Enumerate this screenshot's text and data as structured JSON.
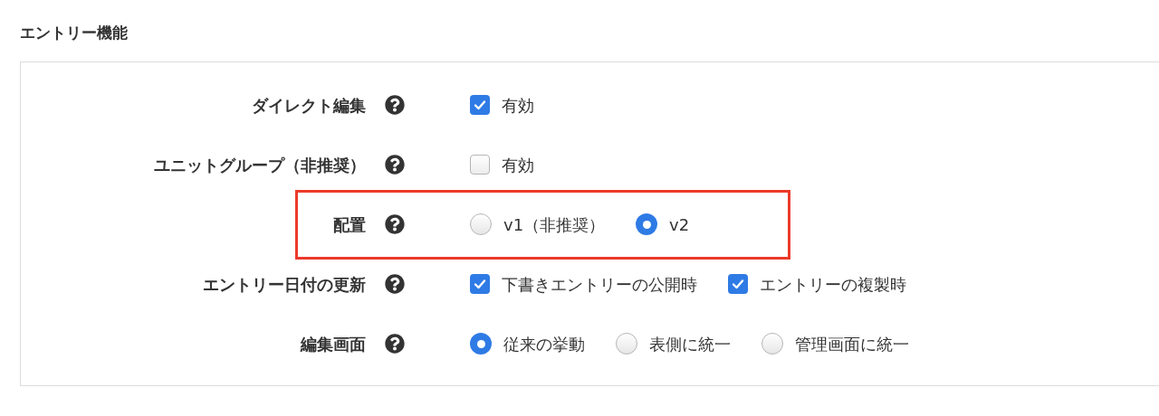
{
  "section_title": "エントリー機能",
  "rows": [
    {
      "label": "ダイレクト編集",
      "kind": "checkbox",
      "highlighted": false,
      "options": [
        {
          "label": "有効",
          "checked": true
        }
      ]
    },
    {
      "label": "ユニットグループ（非推奨）",
      "kind": "checkbox",
      "highlighted": false,
      "options": [
        {
          "label": "有効",
          "checked": false
        }
      ]
    },
    {
      "label": "配置",
      "kind": "radio",
      "highlighted": true,
      "options": [
        {
          "label": "v1（非推奨）",
          "selected": false
        },
        {
          "label": "v2",
          "selected": true
        }
      ]
    },
    {
      "label": "エントリー日付の更新",
      "kind": "checkbox",
      "highlighted": false,
      "options": [
        {
          "label": "下書きエントリーの公開時",
          "checked": true
        },
        {
          "label": "エントリーの複製時",
          "checked": true
        }
      ]
    },
    {
      "label": "編集画面",
      "kind": "radio",
      "highlighted": false,
      "options": [
        {
          "label": "従来の挙動",
          "selected": true
        },
        {
          "label": "表側に統一",
          "selected": false
        },
        {
          "label": "管理画面に統一",
          "selected": false
        }
      ]
    }
  ]
}
